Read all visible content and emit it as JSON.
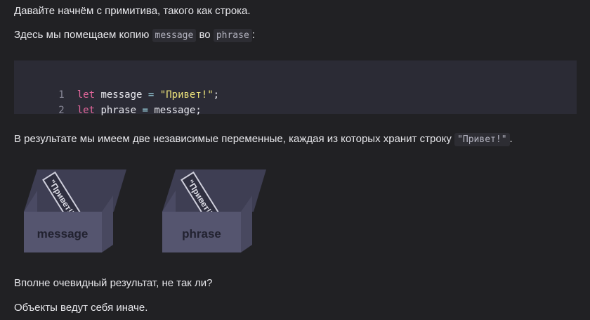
{
  "p1": {
    "text": "Давайте начнём с примитива, такого как строка."
  },
  "p2": {
    "before": "Здесь мы помещаем копию ",
    "code1": "message",
    "middle": " во ",
    "code2": "phrase",
    "after": ":"
  },
  "code": {
    "lines": [
      {
        "number": "1",
        "keyword": "let",
        "name": "message",
        "op": "=",
        "value": "\"Привет!\"",
        "end": ";"
      },
      {
        "number": "2",
        "keyword": "let",
        "name": "phrase",
        "op": "=",
        "value": "message",
        "end": ";"
      }
    ]
  },
  "p3": {
    "before": "В результате мы имеем две независимые переменные, каждая из которых хранит строку ",
    "code": "\"Привет!\"",
    "after": "."
  },
  "illustration": {
    "boxes": [
      {
        "label": "message",
        "note": "\"Привет!\""
      },
      {
        "label": "phrase",
        "note": "\"Привет!\""
      }
    ],
    "colors": {
      "box": "#55556f",
      "box_dark": "#3e3e53",
      "note_border": "#cfcfdc"
    }
  },
  "p4": {
    "text": "Вполне очевидный результат, не так ли?"
  },
  "p5": {
    "text": "Объекты ведут себя иначе."
  }
}
